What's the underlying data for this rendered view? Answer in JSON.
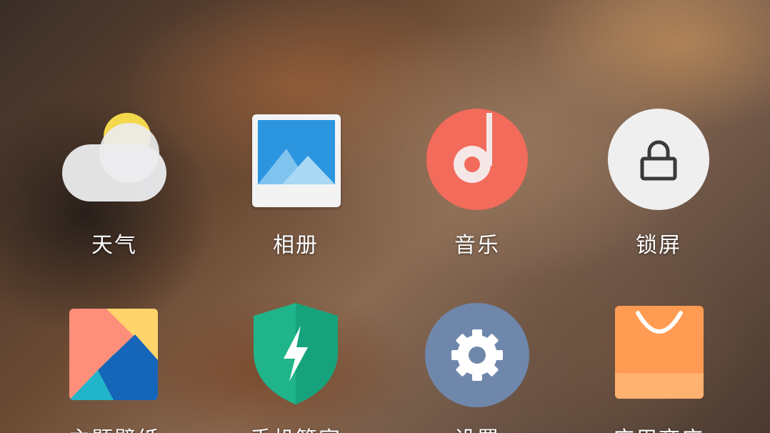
{
  "apps": [
    {
      "label": "天气",
      "icon": "weather-icon"
    },
    {
      "label": "相册",
      "icon": "gallery-icon"
    },
    {
      "label": "音乐",
      "icon": "music-icon"
    },
    {
      "label": "锁屏",
      "icon": "lock-icon"
    },
    {
      "label": "主题壁纸",
      "icon": "theme-wallpaper-icon"
    },
    {
      "label": "手机管家",
      "icon": "security-shield-icon"
    },
    {
      "label": "设置",
      "icon": "settings-gear-icon"
    },
    {
      "label": "应用商店",
      "icon": "app-store-bag-icon"
    }
  ],
  "colors": {
    "weather_sun": "#f4d84c",
    "gallery_sky": "#2b95e0",
    "music": "#f26b5b",
    "lock_bg": "#efefef",
    "security": "#1fb48a",
    "settings": "#6f87ab",
    "store": "#ff9b52"
  }
}
